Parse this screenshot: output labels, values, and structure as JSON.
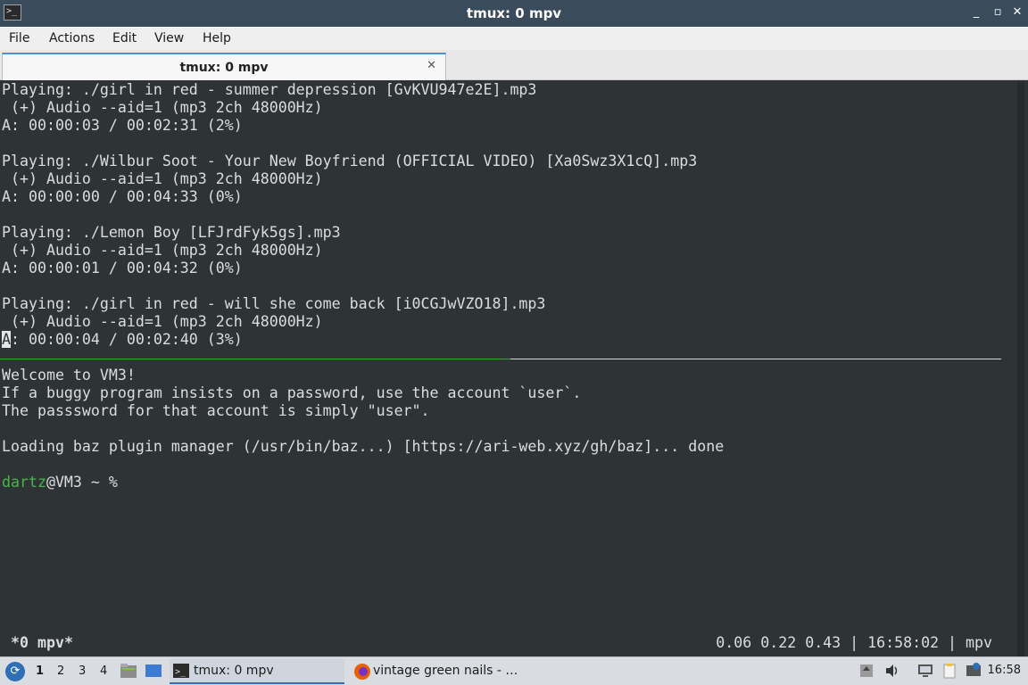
{
  "window": {
    "title": "tmux: 0 mpv",
    "controls": {
      "minimize": "_",
      "restore": "▫",
      "close": "✕"
    }
  },
  "menu": [
    "File",
    "Actions",
    "Edit",
    "View",
    "Help"
  ],
  "tabs": [
    {
      "label": "tmux: 0 mpv",
      "close": "✕"
    }
  ],
  "terminal": {
    "upper_lines": [
      "Playing: ./girl in red - summer depression [GvKVU947e2E].mp3",
      " (+) Audio --aid=1 (mp3 2ch 48000Hz)",
      "A: 00:00:03 / 00:02:31 (2%)",
      "",
      "Playing: ./Wilbur Soot - Your New Boyfriend (OFFICIAL VIDEO) [Xa0Swz3X1cQ].mp3",
      " (+) Audio --aid=1 (mp3 2ch 48000Hz)",
      "A: 00:00:00 / 00:04:33 (0%)",
      "",
      "Playing: ./Lemon Boy [LFJrdFyk5gs].mp3",
      " (+) Audio --aid=1 (mp3 2ch 48000Hz)",
      "A: 00:00:01 / 00:04:32 (0%)",
      "",
      "Playing: ./girl in red - will she come back [i0CGJwVZO18].mp3",
      " (+) Audio --aid=1 (mp3 2ch 48000Hz)"
    ],
    "last_line": {
      "cursor_char": "A",
      "rest": ": 00:00:04 / 00:02:40 (3%)"
    },
    "lower_lines": [
      "Welcome to VM3!",
      "If a buggy program insists on a password, use the account `user`.",
      "The passsword for that account is simply \"user\".",
      "",
      "Loading baz plugin manager (/usr/bin/baz...) [https://ari-web.xyz/gh/baz]... done",
      ""
    ],
    "prompt": {
      "user": "dartz",
      "rest": "@VM3 ~ %"
    },
    "status_left": "*0 mpv*",
    "status_right": "0.06 0.22 0.43 | 16:58:02 | mpv"
  },
  "taskbar": {
    "start_icon": "distro-logo-icon",
    "workspaces": [
      "1",
      "2",
      "3",
      "4"
    ],
    "tasks": [
      {
        "label": "tmux: 0 mpv",
        "icon": "terminal-icon"
      },
      {
        "label": "vintage green nails - …",
        "icon": "firefox-icon"
      }
    ],
    "clock": "16:58"
  },
  "colors": {
    "terminal_bg": "#2e3436",
    "prompt_user": "#4ab44a",
    "titlebar": "#3a4b5c"
  }
}
